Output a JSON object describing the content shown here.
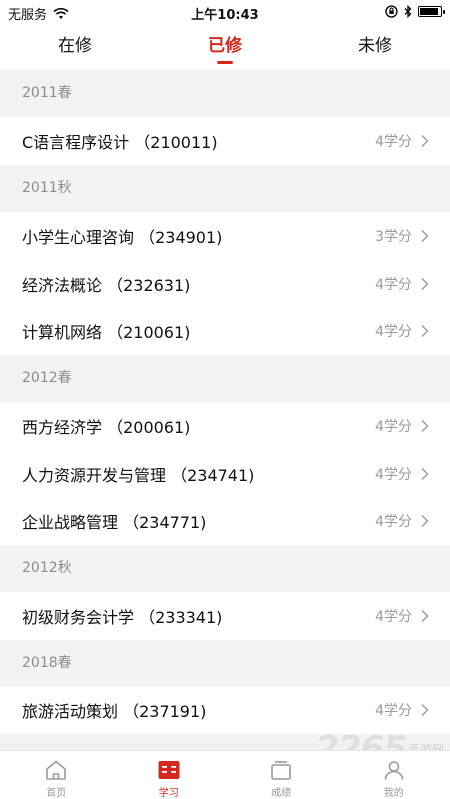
{
  "status": {
    "carrier": "无服务",
    "time": "上午10:43",
    "battery_level": 0.9
  },
  "tabs": [
    {
      "label": "在修",
      "active": false
    },
    {
      "label": "已修",
      "active": true
    },
    {
      "label": "未修",
      "active": false
    }
  ],
  "semesters": [
    {
      "title": "2011春",
      "courses": [
        {
          "name": "C语言程序设计 （210011)",
          "credits": "4学分"
        }
      ]
    },
    {
      "title": "2011秋",
      "courses": [
        {
          "name": "小学生心理咨询 （234901)",
          "credits": "3学分"
        },
        {
          "name": "经济法概论 （232631)",
          "credits": "4学分"
        },
        {
          "name": "计算机网络 （210061)",
          "credits": "4学分"
        }
      ]
    },
    {
      "title": "2012春",
      "courses": [
        {
          "name": "西方经济学 （200061)",
          "credits": "4学分"
        },
        {
          "name": "人力资源开发与管理 （234741)",
          "credits": "4学分"
        },
        {
          "name": "企业战略管理 （234771)",
          "credits": "4学分"
        }
      ]
    },
    {
      "title": "2012秋",
      "courses": [
        {
          "name": "初级财务会计学 （233341)",
          "credits": "4学分"
        }
      ]
    },
    {
      "title": "2018春",
      "courses": [
        {
          "name": "旅游活动策划 （237191)",
          "credits": "4学分"
        }
      ]
    }
  ],
  "bottom_nav": [
    {
      "label": "首页",
      "icon": "home-icon",
      "active": false
    },
    {
      "label": "学习",
      "icon": "study-icon",
      "active": true
    },
    {
      "label": "成绩",
      "icon": "grades-icon",
      "active": false
    },
    {
      "label": "我的",
      "icon": "profile-icon",
      "active": false
    }
  ],
  "watermark": {
    "number": "2265",
    "text": "手游网"
  },
  "colors": {
    "accent": "#d4281f",
    "muted": "#9b9b9b",
    "section_bg": "#f2f2f2"
  }
}
